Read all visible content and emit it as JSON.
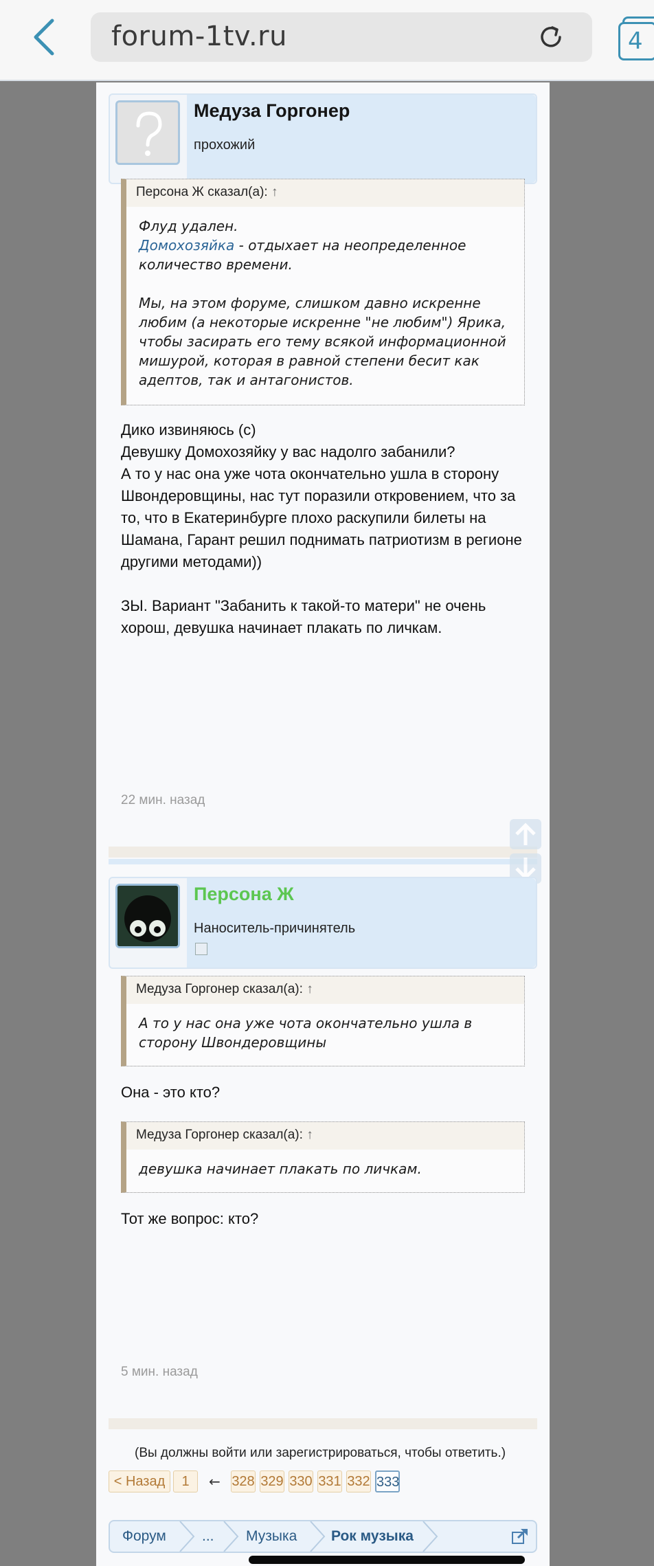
{
  "browser": {
    "url": "forum-1tv.ru",
    "tab_count": "4"
  },
  "posts": [
    {
      "author": "Медуза Горгонер",
      "user_title": "прохожий",
      "name_color": "#111111",
      "quote": {
        "header": "Персона Ж сказал(а):",
        "arrow": "↑",
        "line1": "Флуд удален.",
        "link": "Домохозяйка",
        "line2_rest": " - отдыхает на неопределенное количество времени.",
        "para2": "Мы, на этом форуме, слишком давно искренне любим (а некоторые искренне \"не любим\") Ярика, чтобы засирать его тему всякой информационной мишурой, которая в равной степени бесит как адептов, так и антагонистов."
      },
      "body": "Дико извиняюсь (с)\nДевушку Домохозяйку у вас надолго забанили?\nА то у нас она уже чота окончательно ушла в сторону Швондеровщины, нас тут поразили откровением, что за то, что в Екатеринбурге плохо раскупили билеты на Шамана, Гарант решил поднимать патриотизм в регионе другими методами))\n\nЗЫ. Вариант \"Забанить к такой-то матери\" не очень хорош, девушка начинает плакать по личкам.",
      "time": "22 мин. назад"
    },
    {
      "author": "Персона Ж",
      "user_title": "Наноситель-причинятель",
      "name_color": "#5cc651",
      "quote1": {
        "header": "Медуза Горгонер сказал(а):",
        "arrow": "↑",
        "text": "А то у нас она уже чота окончательно ушла в сторону Швондеровщины"
      },
      "reply1": "Она - это кто?",
      "quote2": {
        "header": "Медуза Горгонер сказал(а):",
        "arrow": "↑",
        "text": "девушка начинает плакать по личкам."
      },
      "reply2": "Тот же вопрос: кто?",
      "time": "5 мин. назад"
    }
  ],
  "login_note": "(Вы должны войти или зарегистрироваться, чтобы ответить.)",
  "pagination": {
    "back": "< Назад",
    "first": "1",
    "ellipsis_arrow": "←",
    "pages": [
      "328",
      "329",
      "330",
      "331",
      "332",
      "333"
    ],
    "current": "333"
  },
  "breadcrumbs": [
    "Форум",
    "...",
    "Музыка",
    "Рок музыка"
  ]
}
